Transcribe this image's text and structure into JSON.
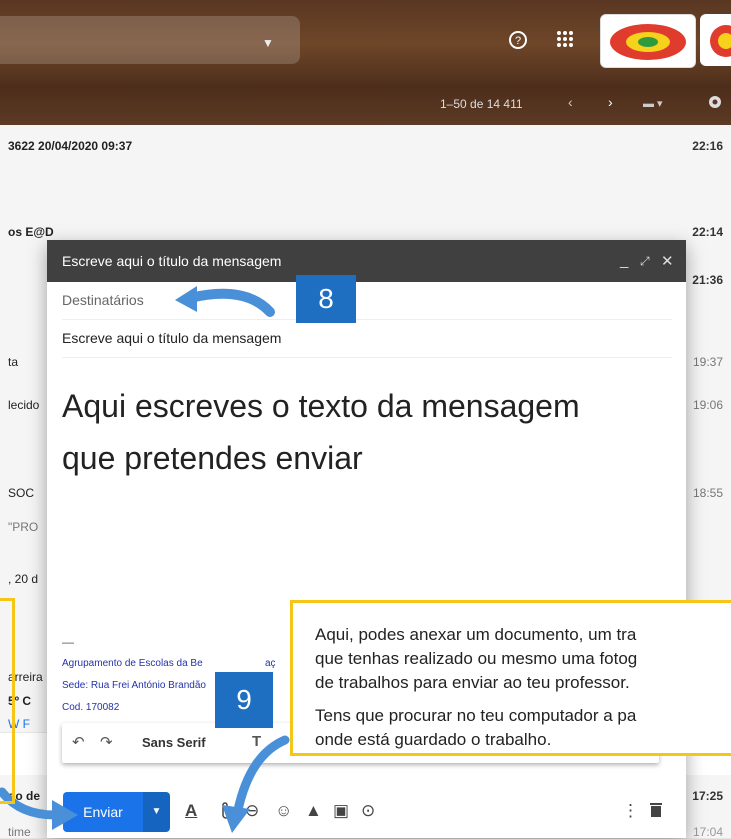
{
  "header": {
    "help_icon": "help-circle-icon",
    "apps_icon": "apps-grid-icon",
    "pager": "1–50 de 14 411",
    "settings_icon": "gear-icon"
  },
  "list": {
    "rows": [
      {
        "text": "3622 20/04/2020 09:37",
        "time": "22:16",
        "bold": true
      },
      {
        "text": "os E@D",
        "time": "22:14",
        "bold": true
      },
      {
        "text": "",
        "time": "21:36",
        "bold": true
      },
      {
        "text": "ta",
        "time": "19:37",
        "bold": false
      },
      {
        "text": "lecido",
        "time": "19:06",
        "bold": false
      },
      {
        "text": "SOC",
        "time": "18:55",
        "bold": false
      },
      {
        "text": "\"PRO",
        "time": "",
        "bold": false
      },
      {
        "text": ", 20 d",
        "time": "",
        "bold": false
      },
      {
        "text": "arreira",
        "time": "",
        "bold": false
      },
      {
        "text": "5º C",
        "time": "",
        "bold": true
      },
      {
        "text": "W F",
        "time": "",
        "bold": false
      },
      {
        "text": "do de",
        "time": "17:25",
        "bold": true
      },
      {
        "text": "time",
        "time": "17:04",
        "bold": false
      }
    ]
  },
  "compose": {
    "title": "Escreve aqui o título da mensagem",
    "recipients_placeholder": "Destinatários",
    "subject": "Escreve aqui o título da mensagem",
    "body_line1": "Aqui escreves o texto da mensagem",
    "body_line2": "que pretendes enviar",
    "sig_dash": "—",
    "sig_line1": "Agrupamento de Escolas da Be",
    "sig_line1b": "aç",
    "sig_line2": "Sede: Rua Frei António Brandão",
    "sig_line3": "Cod. 170082",
    "font_select": "Sans Serif",
    "send_label": "Enviar"
  },
  "annotations": {
    "badge8": "8",
    "badge9": "9",
    "tip_line1": "Aqui, podes anexar um documento, um tra",
    "tip_line2": "que tenhas realizado ou mesmo uma fotog",
    "tip_line3": "de trabalhos para enviar ao teu professor.",
    "tip_line4": "Tens que procurar no teu computador a pa",
    "tip_line5": "onde está guardado o trabalho."
  },
  "colors": {
    "accent": "#1a73e8",
    "highlight": "#f5c518",
    "badge": "#1e6fc2",
    "header_bar": "#404040"
  }
}
